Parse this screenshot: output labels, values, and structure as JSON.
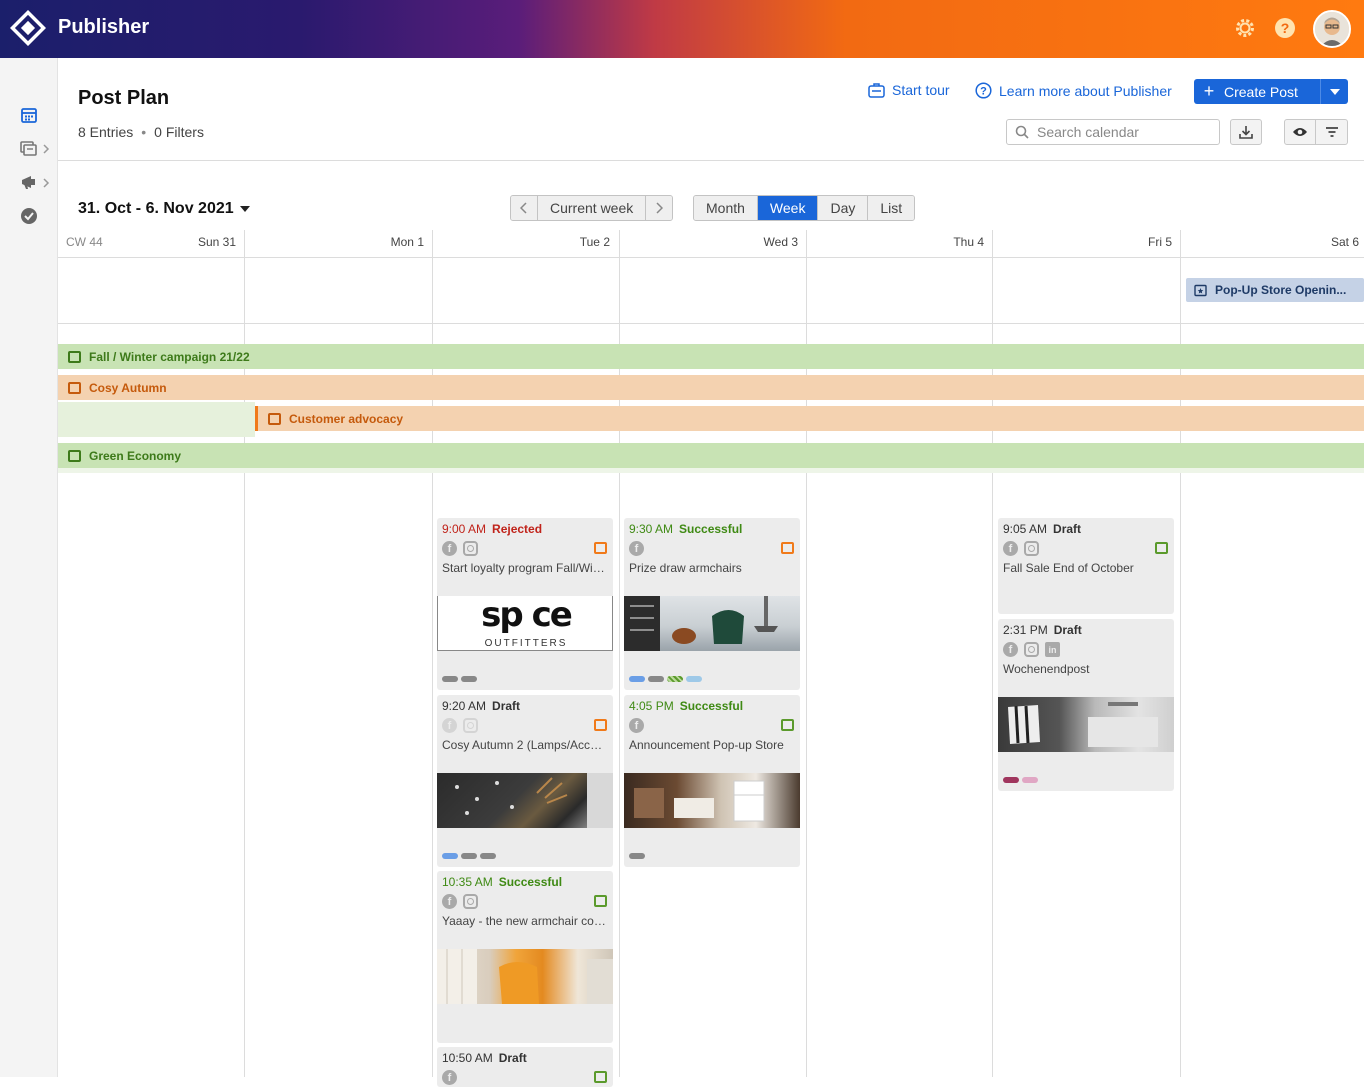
{
  "app": {
    "name": "Publisher"
  },
  "header": {
    "title": "Post Plan",
    "entries": "8 Entries",
    "filters": "0 Filters",
    "start_tour": "Start tour",
    "learn_more": "Learn more about Publisher",
    "create_post": "Create Post",
    "search_placeholder": "Search calendar"
  },
  "toolbar": {
    "range": "31. Oct - 6. Nov 2021",
    "current_week": "Current week",
    "views": [
      "Month",
      "Week",
      "Day",
      "List"
    ],
    "active_view": "Week"
  },
  "calendar": {
    "week_label": "CW 44",
    "days": [
      "Sun 31",
      "Mon 1",
      "Tue 2",
      "Wed 3",
      "Thu 4",
      "Fri 5",
      "Sat 6"
    ],
    "allday_event": "Pop-Up Store Openin...",
    "campaigns": [
      {
        "name": "Fall / Winter campaign 21/22",
        "color": "green"
      },
      {
        "name": "Cosy Autumn",
        "color": "orange"
      },
      {
        "name": "Customer advocacy",
        "color": "orange"
      },
      {
        "name": "Green Economy",
        "color": "green"
      }
    ]
  },
  "posts": [
    {
      "time": "9:00 AM",
      "status": "Rejected",
      "title": "Start loyalty program Fall/Winter",
      "icons": [
        "facebook-icon",
        "instagram-icon"
      ],
      "campaign_color": "orange"
    },
    {
      "time": "9:20 AM",
      "status": "Draft",
      "title": "Cosy Autumn 2 (Lamps/Accessories)",
      "icons": [
        "facebook-icon",
        "instagram-icon"
      ],
      "campaign_color": "orange"
    },
    {
      "time": "10:35 AM",
      "status": "Successful",
      "title": "Yaaay - the new armchair collection",
      "icons": [
        "facebook-icon",
        "instagram-icon"
      ],
      "campaign_color": "green"
    },
    {
      "time": "10:50 AM",
      "status": "Draft",
      "campaign_color": "green"
    },
    {
      "time": "9:30 AM",
      "status": "Successful",
      "title": "Prize draw armchairs",
      "icons": [
        "facebook-icon"
      ],
      "campaign_color": "orange"
    },
    {
      "time": "4:05 PM",
      "status": "Successful",
      "title": "Announcement Pop-up Store",
      "icons": [
        "facebook-icon"
      ],
      "campaign_color": "green"
    },
    {
      "time": "9:05 AM",
      "status": "Draft",
      "title": "Fall Sale End of October",
      "icons": [
        "facebook-icon",
        "instagram-icon"
      ],
      "campaign_color": "green"
    },
    {
      "time": "2:31 PM",
      "status": "Draft",
      "title": "Wochenendpost",
      "icons": [
        "facebook-icon",
        "instagram-icon",
        "linkedin-icon"
      ]
    }
  ],
  "logo_text": {
    "line1": "sp ce",
    "line2": "OUTFITTERS"
  },
  "colors": {
    "accent": "#1a66d9",
    "rejected": "#c0231a",
    "successful": "#3f8a14",
    "draft": "#333333",
    "green_campaign": "#5b9a2c",
    "orange_campaign": "#f07a1a"
  }
}
